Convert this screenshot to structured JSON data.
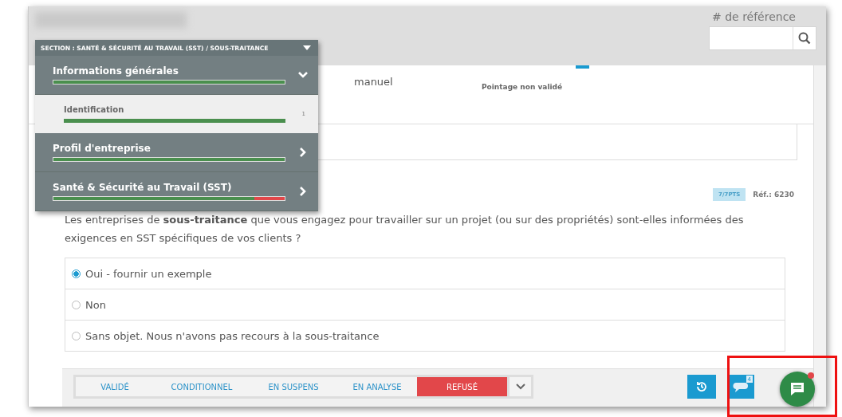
{
  "header": {
    "reference_label": "# de référence"
  },
  "section_menu": {
    "title": "SECTION : SANTÉ & SÉCURITÉ AU TRAVAIL (SST) / SOUS-TRAITANCE",
    "items": [
      {
        "label": "Informations générales",
        "level": 1,
        "expanded": true,
        "children": [
          {
            "label": "Identification",
            "count": "1",
            "level": 1
          }
        ]
      },
      {
        "label": "Profil d'entreprise",
        "level": 1,
        "expanded": false
      },
      {
        "label": "Santé & Sécurité au Travail (SST)",
        "level": 0.87,
        "expanded": false
      }
    ]
  },
  "summary": {
    "partial_text": "manuel",
    "score_status": "Pointage non validé"
  },
  "question": {
    "points": "7/7PTS",
    "reference": "Réf.: 6230",
    "text": "Les entreprises de **sous-traitance** que vous engagez pour travailler sur un projet (ou sur des propriétés) sont-elles informées des exigences en SST spécifiques de vos clients ?",
    "options": [
      {
        "label": "Oui - fournir un exemple",
        "selected": true
      },
      {
        "label": "Non",
        "selected": false
      },
      {
        "label": "Sans objet. Nous n'avons pas recours à la sous-traitance",
        "selected": false
      }
    ]
  },
  "review": {
    "statuses": [
      {
        "label": "VALIDÉ",
        "selected": false
      },
      {
        "label": "CONDITIONNEL",
        "selected": false
      },
      {
        "label": "EN SUSPENS",
        "selected": false
      },
      {
        "label": "EN ANALYSE",
        "selected": false
      },
      {
        "label": "REFUSÉ",
        "selected": true
      }
    ],
    "comment_count": "4",
    "chat_unread": true
  }
}
